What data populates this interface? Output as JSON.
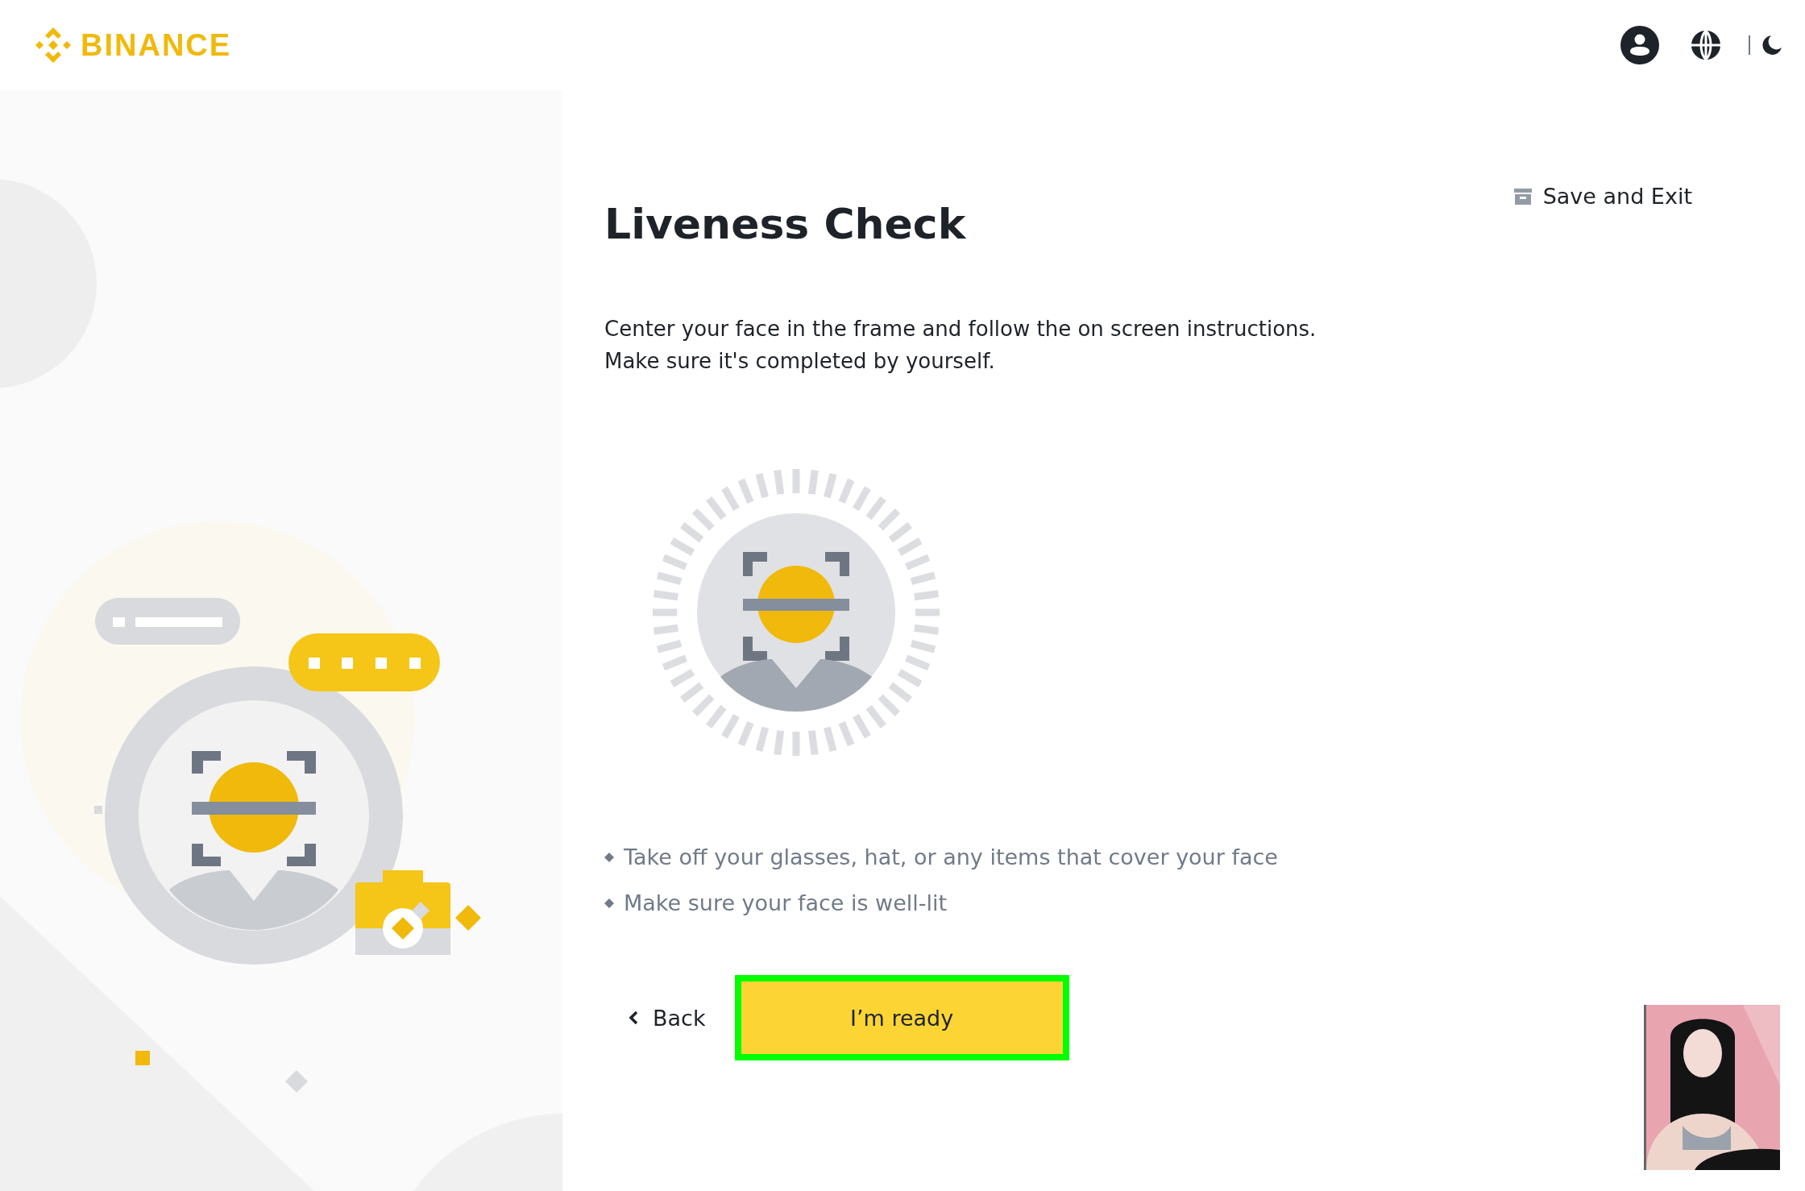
{
  "header": {
    "logo": "BINANCE"
  },
  "title": "Liveness Check",
  "save_exit": "Save and Exit",
  "description": [
    "Center your face in the frame and follow the on screen instructions.",
    "Make sure it's completed by yourself."
  ],
  "tips": [
    "Take off your glasses, hat, or any items that cover your face",
    "Make sure your face is well-lit"
  ],
  "back": "Back",
  "ready": {
    "label": "I’m ready",
    "highlighted": true
  }
}
